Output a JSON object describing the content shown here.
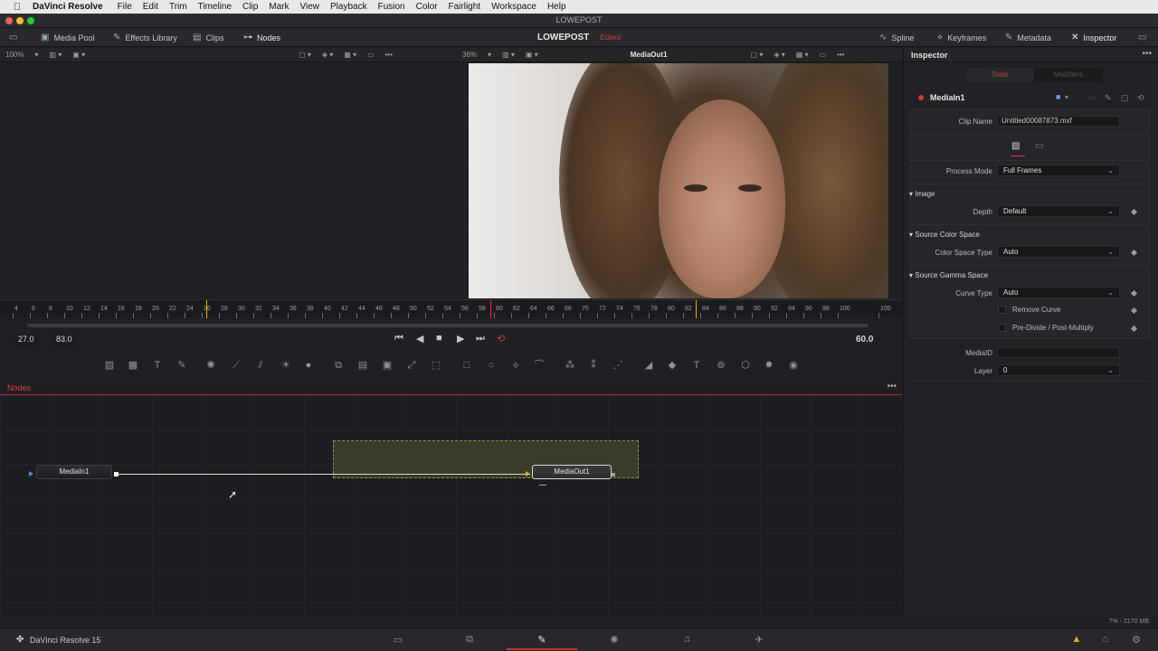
{
  "menubar": {
    "app_name": "DaVinci Resolve",
    "items": [
      "File",
      "Edit",
      "Trim",
      "Timeline",
      "Clip",
      "Mark",
      "View",
      "Playback",
      "Fusion",
      "Color",
      "Fairlight",
      "Workspace",
      "Help"
    ]
  },
  "window": {
    "title": "LOWEPOST"
  },
  "toolbar": {
    "media_pool": "Media Pool",
    "effects_library": "Effects Library",
    "clips": "Clips",
    "nodes": "Nodes",
    "project_name": "LOWEPOST",
    "project_status": "Edited",
    "spline": "Spline",
    "keyframes": "Keyframes",
    "metadata": "Metadata",
    "inspector": "Inspector"
  },
  "viewer_left": {
    "zoom": "100%"
  },
  "viewer_right": {
    "zoom": "36%",
    "title": "MediaOut1"
  },
  "ruler": {
    "labels": [
      "4",
      "6",
      "8",
      "10",
      "12",
      "14",
      "16",
      "18",
      "20",
      "22",
      "24",
      "26",
      "28",
      "30",
      "32",
      "34",
      "36",
      "38",
      "40",
      "42",
      "44",
      "46",
      "48",
      "50",
      "52",
      "54",
      "56",
      "58",
      "60",
      "62",
      "64",
      "66",
      "68",
      "70",
      "72",
      "74",
      "76",
      "78",
      "80",
      "82",
      "84",
      "86",
      "88",
      "90",
      "92",
      "94",
      "96",
      "98",
      "100",
      "105"
    ]
  },
  "transport": {
    "render_start": "27.0",
    "render_end": "83.0",
    "current_frame": "60.0"
  },
  "nodes": {
    "panel_title": "Nodes",
    "media_in": "MediaIn1",
    "media_out": "MediaOut1"
  },
  "inspector": {
    "title": "Inspector",
    "tab_tools": "Tools",
    "tab_modifiers": "Modifiers",
    "node_name": "MediaIn1",
    "clip_name_label": "Clip Name",
    "clip_name_value": "Untitled00087873.mxf",
    "process_mode_label": "Process Mode",
    "process_mode_value": "Full Frames",
    "section_image": "Image",
    "depth_label": "Depth",
    "depth_value": "Default",
    "section_color_space": "Source Color Space",
    "color_space_type_label": "Color Space Type",
    "color_space_type_value": "Auto",
    "section_gamma_space": "Source Gamma Space",
    "curve_type_label": "Curve Type",
    "curve_type_value": "Auto",
    "remove_curve": "Remove Curve",
    "predivide": "Pre-Divide / Post-Multiply",
    "mediaid_label": "MediaID",
    "mediaid_value": "",
    "layer_label": "Layer",
    "layer_value": "0"
  },
  "status": {
    "memory": "7% - 2170 MB"
  },
  "bottombar": {
    "brand": "DaVinci Resolve 15"
  },
  "colors": {
    "accent_red": "#d23a3a",
    "playhead_yellow": "#e0b020",
    "active_page": "#c0302f"
  }
}
